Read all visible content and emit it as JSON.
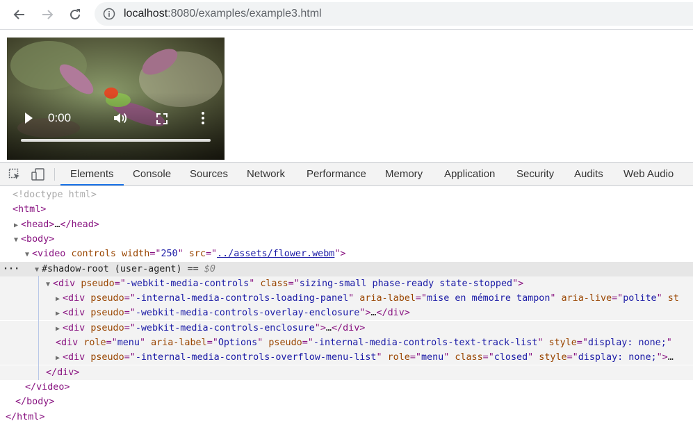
{
  "browser": {
    "url_host": "localhost",
    "url_rest": ":8080/examples/example3.html"
  },
  "video": {
    "time": "0:00",
    "progress": 0
  },
  "devtools": {
    "tabs": [
      "Elements",
      "Console",
      "Sources",
      "Network",
      "Performance",
      "Memory",
      "Application",
      "Security",
      "Audits",
      "Web Audio"
    ],
    "active_tab": "Elements",
    "lines": [
      {
        "indent": 18,
        "tri": "",
        "html": "<span class='doctype'>&lt;!doctype html&gt;</span>"
      },
      {
        "indent": 18,
        "tri": "",
        "html": "<span class='tag'>&lt;html&gt;</span>"
      },
      {
        "indent": 20,
        "tri": "▶",
        "html": "<span class='tag'>&lt;head&gt;</span><span class='txt'>…</span><span class='tag'>&lt;/head&gt;</span>"
      },
      {
        "indent": 20,
        "tri": "▼",
        "html": "<span class='tag'>&lt;body&gt;</span>"
      },
      {
        "indent": 36,
        "tri": "▼",
        "html": "<span class='tag'>&lt;video </span><span class='attr'>controls</span> <span class='attr'>width</span><span class='tag'>=\"</span><span class='val'>250</span><span class='tag'>\"</span> <span class='attr'>src</span><span class='tag'>=\"</span><span class='link'>../assets/flower.webm</span><span class='tag'>\"&gt;</span>"
      },
      {
        "indent": 50,
        "tri": "▼",
        "html": "<span class='txt'>#shadow-root (user-agent)</span> <span class='txt'>==</span> <span class='ital'>$0</span>",
        "sel": true
      },
      {
        "indent": 66,
        "tri": "▼",
        "html": "<span class='tag'>&lt;div </span><span class='attr'>pseudo</span><span class='tag'>=\"</span><span class='val'>-webkit-media-controls</span><span class='tag'>\"</span> <span class='attr'>class</span><span class='tag'>=\"</span><span class='val'>sizing-small phase-ready state-stopped</span><span class='tag'>\"&gt;</span>",
        "shadow": true
      },
      {
        "indent": 80,
        "tri": "▶",
        "html": "<span class='tag'>&lt;div </span><span class='attr'>pseudo</span><span class='tag'>=\"</span><span class='val'>-internal-media-controls-loading-panel</span><span class='tag'>\"</span> <span class='attr'>aria-label</span><span class='tag'>=\"</span><span class='val'>mise en mémoire tampon</span><span class='tag'>\"</span> <span class='attr'>aria-live</span><span class='tag'>=\"</span><span class='val'>polite</span><span class='tag'>\"</span> <span class='attr'>st</span>",
        "shadow": true
      },
      {
        "indent": 80,
        "tri": "▶",
        "html": "<span class='tag'>&lt;div </span><span class='attr'>pseudo</span><span class='tag'>=\"</span><span class='val'>-webkit-media-controls-overlay-enclosure</span><span class='tag'>\"&gt;</span><span class='txt'>…</span><span class='tag'>&lt;/div&gt;</span>",
        "shadow": true
      },
      {
        "indent": 80,
        "tri": "▶",
        "html": "<span class='tag'>&lt;div </span><span class='attr'>pseudo</span><span class='tag'>=\"</span><span class='val'>-webkit-media-controls-enclosure</span><span class='tag'>\"&gt;</span><span class='txt'>…</span><span class='tag'>&lt;/div&gt;</span>",
        "shadow": true
      },
      {
        "indent": 80,
        "tri": "",
        "html": "<span class='tag'>&lt;div </span><span class='attr'>role</span><span class='tag'>=\"</span><span class='val'>menu</span><span class='tag'>\"</span> <span class='attr'>aria-label</span><span class='tag'>=\"</span><span class='val'>Options</span><span class='tag'>\"</span> <span class='attr'>pseudo</span><span class='tag'>=\"</span><span class='val'>-internal-media-controls-text-track-list</span><span class='tag'>\"</span> <span class='attr'>style</span><span class='tag'>=\"</span><span class='val'>display: none;</span><span class='tag'>\"</span>",
        "shadow": true
      },
      {
        "indent": 80,
        "tri": "▶",
        "html": "<span class='tag'>&lt;div </span><span class='attr'>pseudo</span><span class='tag'>=\"</span><span class='val'>-internal-media-controls-overflow-menu-list</span><span class='tag'>\"</span> <span class='attr'>role</span><span class='tag'>=\"</span><span class='val'>menu</span><span class='tag'>\"</span> <span class='attr'>class</span><span class='tag'>=\"</span><span class='val'>closed</span><span class='tag'>\"</span> <span class='attr'>style</span><span class='tag'>=\"</span><span class='val'>display: none;</span><span class='tag'>\"&gt;</span><span class='txt'>…</span>",
        "shadow": true
      },
      {
        "indent": 66,
        "tri": "",
        "html": "<span class='tag'>&lt;/div&gt;</span>",
        "shadow": true
      },
      {
        "indent": 36,
        "tri": "",
        "html": "<span class='tag'>&lt;/video&gt;</span>"
      },
      {
        "indent": 22,
        "tri": "",
        "html": "<span class='tag'>&lt;/body&gt;</span>"
      },
      {
        "indent": 8,
        "tri": "",
        "html": "<span class='tag'>&lt;/html&gt;</span>"
      }
    ]
  }
}
